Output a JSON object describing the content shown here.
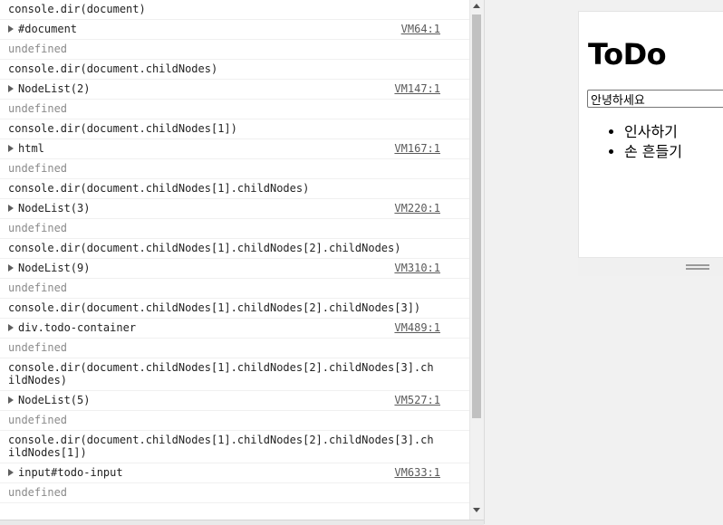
{
  "console": {
    "entries": [
      {
        "kind": "input",
        "text": "console.dir(document)"
      },
      {
        "kind": "output",
        "text": "#document",
        "source": "VM64:1"
      },
      {
        "kind": "result",
        "text": "undefined"
      },
      {
        "kind": "input",
        "text": "console.dir(document.childNodes)"
      },
      {
        "kind": "output",
        "text": "NodeList(2)",
        "source": "VM147:1"
      },
      {
        "kind": "result",
        "text": "undefined"
      },
      {
        "kind": "input",
        "text": "console.dir(document.childNodes[1])"
      },
      {
        "kind": "output",
        "text": "html",
        "source": "VM167:1"
      },
      {
        "kind": "result",
        "text": "undefined"
      },
      {
        "kind": "input",
        "text": "console.dir(document.childNodes[1].childNodes)"
      },
      {
        "kind": "output",
        "text": "NodeList(3)",
        "source": "VM220:1"
      },
      {
        "kind": "result",
        "text": "undefined"
      },
      {
        "kind": "input",
        "text": "console.dir(document.childNodes[1].childNodes[2].childNodes)"
      },
      {
        "kind": "output",
        "text": "NodeList(9)",
        "source": "VM310:1"
      },
      {
        "kind": "result",
        "text": "undefined"
      },
      {
        "kind": "input",
        "text": "console.dir(document.childNodes[1].childNodes[2].childNodes[3])"
      },
      {
        "kind": "output",
        "text": "div.todo-container",
        "source": "VM489:1"
      },
      {
        "kind": "result",
        "text": "undefined"
      },
      {
        "kind": "input",
        "text": "console.dir(document.childNodes[1].childNodes[2].childNodes[3].childNodes)"
      },
      {
        "kind": "output",
        "text": "NodeList(5)",
        "source": "VM527:1"
      },
      {
        "kind": "result",
        "text": "undefined"
      },
      {
        "kind": "input",
        "text": "console.dir(document.childNodes[1].childNodes[2].childNodes[3].childNodes[1])"
      },
      {
        "kind": "output",
        "text": "input#todo-input",
        "source": "VM633:1"
      },
      {
        "kind": "result",
        "text": "undefined"
      }
    ]
  },
  "preview": {
    "title": "ToDo",
    "input_value": "안녕하세요",
    "items": [
      "인사하기",
      "손 흔들기"
    ]
  },
  "icons": {
    "expand": "expand-triangle-icon",
    "scroll_up": "scroll-up-arrow-icon",
    "scroll_down": "scroll-down-arrow-icon",
    "resize": "resize-handle-icon"
  },
  "colors": {
    "link": "#5a5a5a",
    "undefined_text": "#8a8a8a",
    "scroll_thumb": "#c1c1c1"
  }
}
